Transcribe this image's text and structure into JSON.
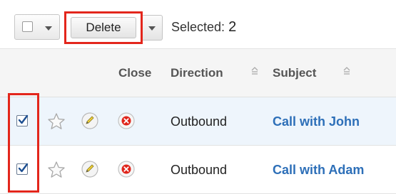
{
  "toolbar": {
    "delete_label": "Delete",
    "selected_label": "Selected:",
    "selected_count": "2"
  },
  "table": {
    "columns": [
      {
        "label": "Close",
        "sortable": false
      },
      {
        "label": "Direction",
        "sortable": true
      },
      {
        "label": "Subject",
        "sortable": true
      }
    ],
    "rows": [
      {
        "checked": true,
        "direction": "Outbound",
        "subject": "Call with John"
      },
      {
        "checked": true,
        "direction": "Outbound",
        "subject": "Call with Adam"
      }
    ]
  },
  "colors": {
    "highlight": "#e3261c",
    "link": "#2d6fb8",
    "selected_row_bg": "#eef5fc",
    "header_bg": "#f5f5f5"
  },
  "icons": {
    "star": "star-icon",
    "edit": "pencil-icon",
    "close": "close-icon",
    "sort": "sort-icon",
    "dropdown": "chevron-down-icon"
  }
}
